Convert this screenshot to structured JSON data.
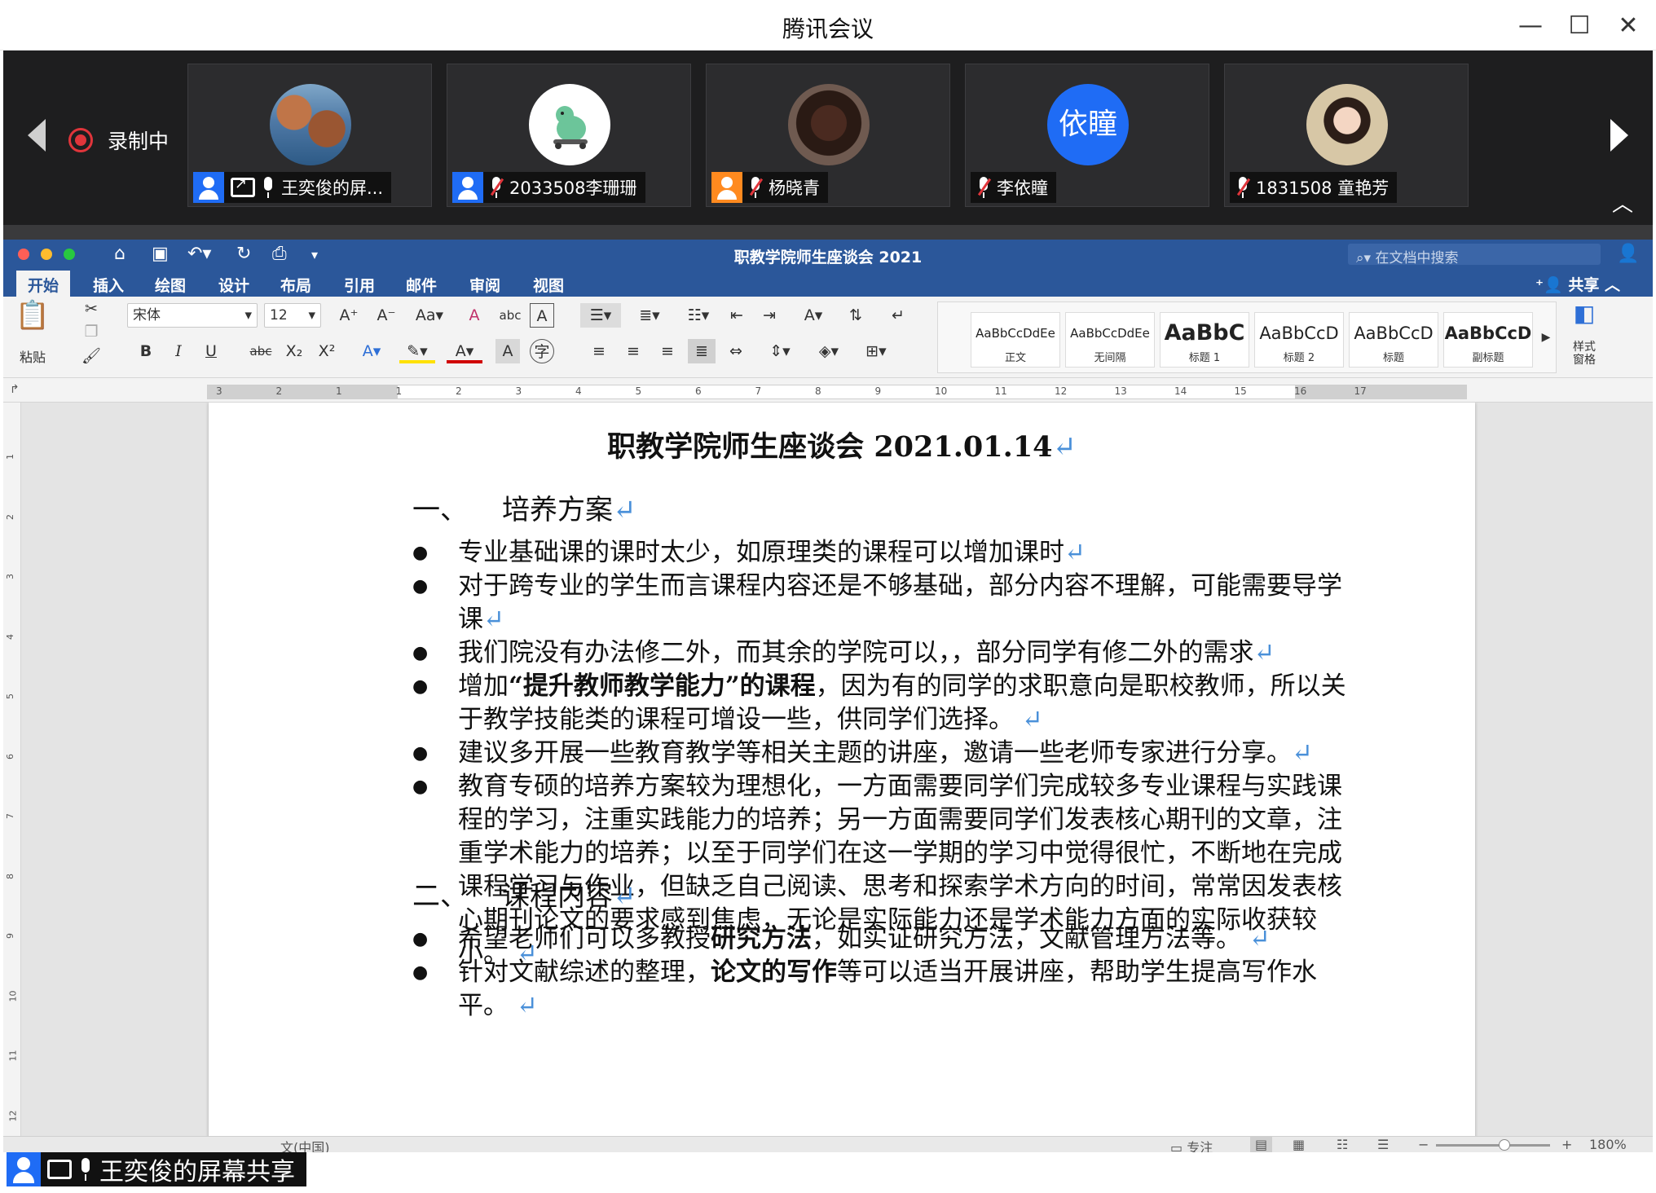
{
  "meeting": {
    "title": "腾讯会议",
    "recording_label": "录制中",
    "participants": [
      {
        "name": "王奕俊的屏...",
        "avatar": "landscape-photo",
        "sharing": true,
        "mic": "on",
        "user_icon": "blue"
      },
      {
        "name": "2033508李珊珊",
        "avatar": "dinosaur-cartoon",
        "mic": "muted",
        "user_icon": "blue"
      },
      {
        "name": "杨晓青",
        "avatar": "face-photo",
        "mic": "muted",
        "user_icon": "orange"
      },
      {
        "name": "李依瞳",
        "avatar_text": "依瞳",
        "avatar_color": "#1f6cf5",
        "mic": "muted"
      },
      {
        "name": "1831508 童艳芳",
        "avatar": "portrait-photo",
        "mic": "muted"
      }
    ],
    "screen_share_label": "王奕俊的屏幕共享"
  },
  "word": {
    "doc_title": "职教学院师生座谈会 2021",
    "search_placeholder": "在文档中搜索",
    "tabs": [
      "开始",
      "插入",
      "绘图",
      "设计",
      "布局",
      "引用",
      "邮件",
      "审阅",
      "视图"
    ],
    "share_label": "共享",
    "ribbon": {
      "paste_label": "粘贴",
      "font_name": "宋体",
      "font_size": "12",
      "styles": [
        {
          "preview": "AaBbCcDdEe",
          "name": "正文"
        },
        {
          "preview": "AaBbCcDdEe",
          "name": "无间隔"
        },
        {
          "preview": "AaBbC",
          "name": "标题 1"
        },
        {
          "preview": "AaBbCcD",
          "name": "标题 2"
        },
        {
          "preview": "AaBbCcD",
          "name": "标题"
        },
        {
          "preview": "AaBbCcD",
          "name": "副标题"
        }
      ],
      "styles_pane_label": "样式\n窗格"
    },
    "ruler_numbers": [
      "3",
      "2",
      "1",
      "1",
      "2",
      "3",
      "4",
      "5",
      "6",
      "7",
      "8",
      "9",
      "10",
      "11",
      "12",
      "13",
      "14",
      "15",
      "16",
      "17"
    ],
    "vruler_numbers": [
      "1",
      "2",
      "3",
      "4",
      "5",
      "6",
      "7",
      "8",
      "9",
      "10",
      "11",
      "12"
    ],
    "document": {
      "title": "职教学院师生座谈会  2021.01.14",
      "section1": {
        "num": "一、",
        "heading": "培养方案"
      },
      "section1_items": [
        "专业基础课的课时太少，如原理类的课程可以增加课时",
        "对于跨专业的学生而言课程内容还是不够基础，部分内容不理解，可能需要导学课",
        "我们院没有办法修二外，而其余的学院可以，，部分同学有修二外的需求",
        "建议多开展一些教育教学等相关主题的讲座，邀请一些老师专家进行分享。",
        "教育专硕的培养方案较为理想化，一方面需要同学们完成较多专业课程与实践课程的学习，注重实践能力的培养；另一方面需要同学们发表核心期刊的文章，注重学术能力的培养；以至于同学们在这一学期的学习中觉得很忙，不断地在完成课程学习与作业，但缺乏自己阅读、思考和探索学术方向的时间，常常因发表核心期刊论文的要求感到焦虑，无论是实际能力还是学术能力方面的实际收获较小。"
      ],
      "item4": {
        "pre": "增加",
        "bold": "“提升教师教学能力”的课程",
        "post": "，因为有的同学的求职意向是职校教师，所以关于教学技能类的课程可增设一些，供同学们选择。"
      },
      "section2": {
        "num": "二、",
        "heading": "课程内容"
      },
      "s2_item1": {
        "pre": "希望老师们可以多教授",
        "bold": "研究方法",
        "post": "，如实证研究方法，文献管理方法等。"
      },
      "s2_item2": {
        "pre": "针对文献综述的整理，",
        "bold": "论文的写作",
        "post": "等可以适当开展讲座，帮助学生提高写作水平。"
      }
    },
    "status": {
      "language": "文(中国)",
      "focus_label": "专注",
      "zoom": "180%",
      "zoom_level": 0.6
    }
  }
}
